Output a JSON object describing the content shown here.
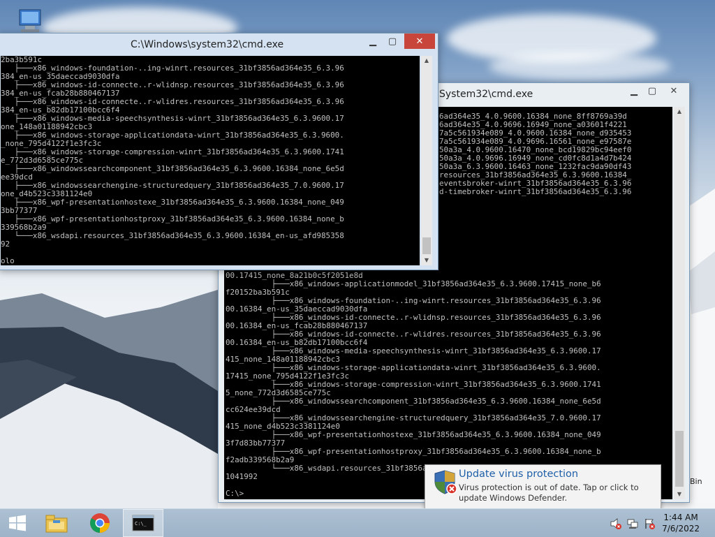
{
  "desktop": {
    "recycle_bin_fragment": "Bin"
  },
  "window_front": {
    "title": "C:\\Windows\\system32\\cmd.exe",
    "lines": [
      "2ba3b591c",
      "   ├───x86_windows-foundation-..ing-winrt.resources_31bf3856ad364e35_6.3.96",
      "384_en-us_35daeccad9030dfa",
      "   ├───x86_windows-id-connecte..r-wlidnsp.resources_31bf3856ad364e35_6.3.96",
      "384_en-us_fcab28b880467137",
      "   ├───x86_windows-id-connecte..r-wlidres.resources_31bf3856ad364e35_6.3.96",
      "384_en-us_b82db17100bcc6f4",
      "   ├───x86_windows-media-speechsynthesis-winrt_31bf3856ad364e35_6.3.9600.17",
      "one_148a01188942cbc3",
      "   ├───x86_windows-storage-applicationdata-winrt_31bf3856ad364e35_6.3.9600.",
      "_none_795d4122f1e3fc3c",
      "   ├───x86_windows-storage-compression-winrt_31bf3856ad364e35_6.3.9600.1741",
      "e_772d3d6585ce775c",
      "   ├───x86_windowssearchcomponent_31bf3856ad364e35_6.3.9600.16384_none_6e5d",
      "ee39dcd",
      "   ├───x86_windowssearchengine-structuredquery_31bf3856ad364e35_7.0.9600.17",
      "one_d4b523c3381124e0",
      "   ├───x86_wpf-presentationhostexe_31bf3856ad364e35_6.3.9600.16384_none_049",
      "3bb77377",
      "   ├───x86_wpf-presentationhostproxy_31bf3856ad364e35_6.3.9600.16384_none_b",
      "339568b2a9",
      "   └───x86_wsdapi.resources_31bf3856ad364e35_6.3.9600.16384_en-us_afd985358",
      "92",
      "",
      "olo"
    ]
  },
  "window_back": {
    "title": "System32\\cmd.exe",
    "top_lines": [
      "6ad364e35_4.0.9600.16384_none_8ff8769a39d",
      "6ad364e35_4.0.9696.16949_none_a03601f4221",
      "7a5c561934e089_4.0.9600.16384_none_d935453",
      "7a5c561934e089_4.0.9696.16561_none_e97587e",
      "50a3a_4.0.9600.16470_none_bcd19829bc94eef0",
      "50a3a_4.0.9696.16949_none_cd0fc8d1a4d7b424",
      "50a3a_6.3.9600.16463_none_1232fac9da90df43",
      "resources_31bf3856ad364e35_6.3.9600.16384_",
      "eventsbroker-winrt_31bf3856ad364e35_6.3.96",
      "d-timebroker-winrt_31bf3856ad364e35_6.3.96"
    ],
    "lines": [
      "00.17415_none_8a21b0c5f2051e8d",
      "          ├───x86_windows-applicationmodel_31bf3856ad364e35_6.3.9600.17415_none_b6",
      "f20152ba3b591c",
      "          ├───x86_windows-foundation-..ing-winrt.resources_31bf3856ad364e35_6.3.96",
      "00.16384_en-us_35daeccad9030dfa",
      "          ├───x86_windows-id-connecte..r-wlidnsp.resources_31bf3856ad364e35_6.3.96",
      "00.16384_en-us_fcab28b880467137",
      "          ├───x86_windows-id-connecte..r-wlidres.resources_31bf3856ad364e35_6.3.96",
      "00.16384_en-us_b82db17100bcc6f4",
      "          ├───x86_windows-media-speechsynthesis-winrt_31bf3856ad364e35_6.3.9600.17",
      "415_none_148a01188942cbc3",
      "          ├───x86_windows-storage-applicationdata-winrt_31bf3856ad364e35_6.3.9600.",
      "17415_none_795d4122f1e3fc3c",
      "          ├───x86_windows-storage-compression-winrt_31bf3856ad364e35_6.3.9600.1741",
      "5_none_772d3d6585ce775c",
      "          ├───x86_windowssearchcomponent_31bf3856ad364e35_6.3.9600.16384_none_6e5d",
      "cc624ee39dcd",
      "          ├───x86_windowssearchengine-structuredquery_31bf3856ad364e35_7.0.9600.17",
      "415_none_d4b523c3381124e0",
      "          ├───x86_wpf-presentationhostexe_31bf3856ad364e35_6.3.9600.16384_none_049",
      "3f7d83bb77377",
      "          ├───x86_wpf-presentationhostproxy_31bf3856ad364e35_6.3.9600.16384_none_b",
      "f2adb339568b2a9",
      "          └───x86_wsdapi.resources_31bf3856ad364e35_6.3.9600.16384_en-us_afd985358",
      "1041992",
      "",
      "C:\\>"
    ]
  },
  "toast": {
    "title": "Update virus protection",
    "message": "Virus protection is out of date. Tap or click to update Windows Defender."
  },
  "taskbar": {
    "apps": [
      "start-icon",
      "file-explorer-icon",
      "chrome-icon",
      "cmd-icon"
    ],
    "time": "1:44 AM",
    "date": "7/6/2022"
  },
  "colors": {
    "console_bg": "#000000",
    "console_fg": "#c0c0c0",
    "close_button": "#c7453b",
    "toast_title": "#1e5fa8"
  }
}
